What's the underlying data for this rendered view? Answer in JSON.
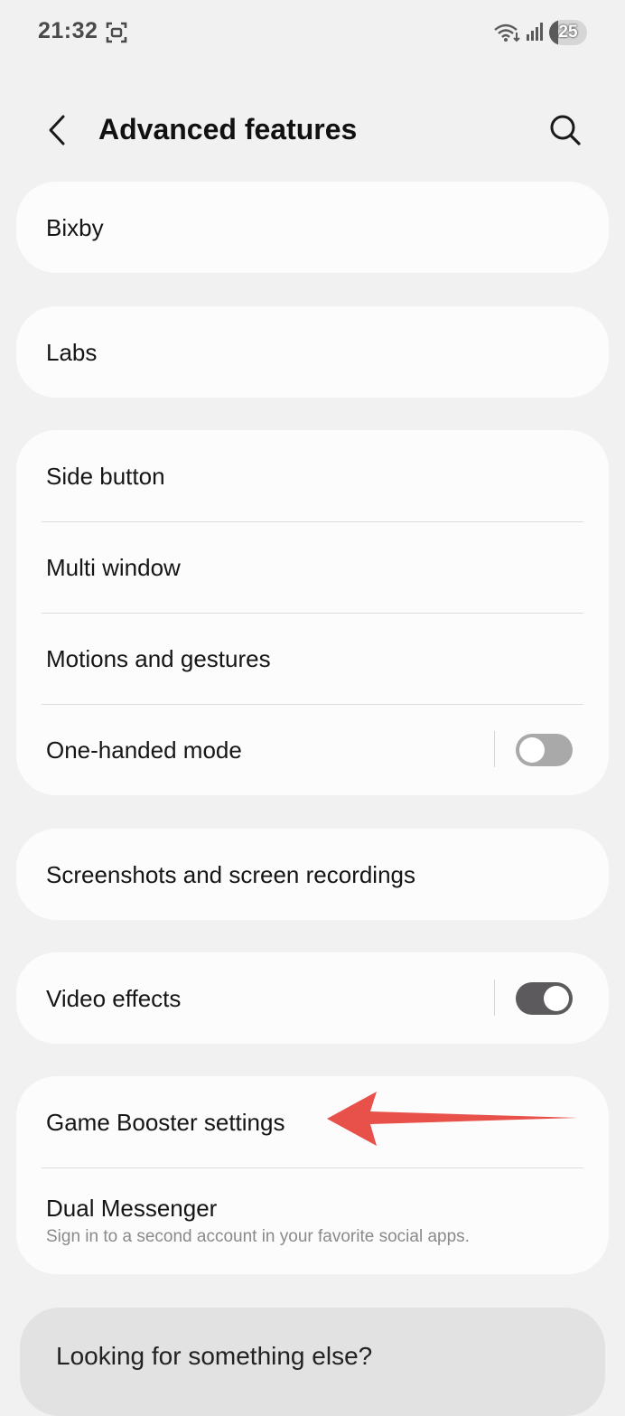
{
  "status_bar": {
    "time": "21:32",
    "battery_level": "25",
    "icons": [
      "screenshot-icon",
      "wifi-icon",
      "signal-icon",
      "battery-icon"
    ]
  },
  "header": {
    "title": "Advanced features",
    "back_icon": "chevron-left-icon",
    "search_icon": "search-icon"
  },
  "items": {
    "bixby": "Bixby",
    "labs": "Labs",
    "side_button": "Side button",
    "multi_window": "Multi window",
    "motions_gestures": "Motions and gestures",
    "one_handed_mode": "One-handed mode",
    "screenshots": "Screenshots and screen recordings",
    "video_effects": "Video effects",
    "game_booster": "Game Booster settings",
    "dual_messenger": "Dual Messenger",
    "dual_messenger_sub": "Sign in to a second account in your favorite social apps."
  },
  "toggles": {
    "one_handed_mode": false,
    "video_effects": true
  },
  "bottom": {
    "label": "Looking for something else?"
  },
  "colors": {
    "background": "#f1f1f1",
    "card": "#fcfcfc",
    "arrow": "#e8504a",
    "toggle_on": "#5c5a5c",
    "toggle_off": "#a9a9a9"
  }
}
